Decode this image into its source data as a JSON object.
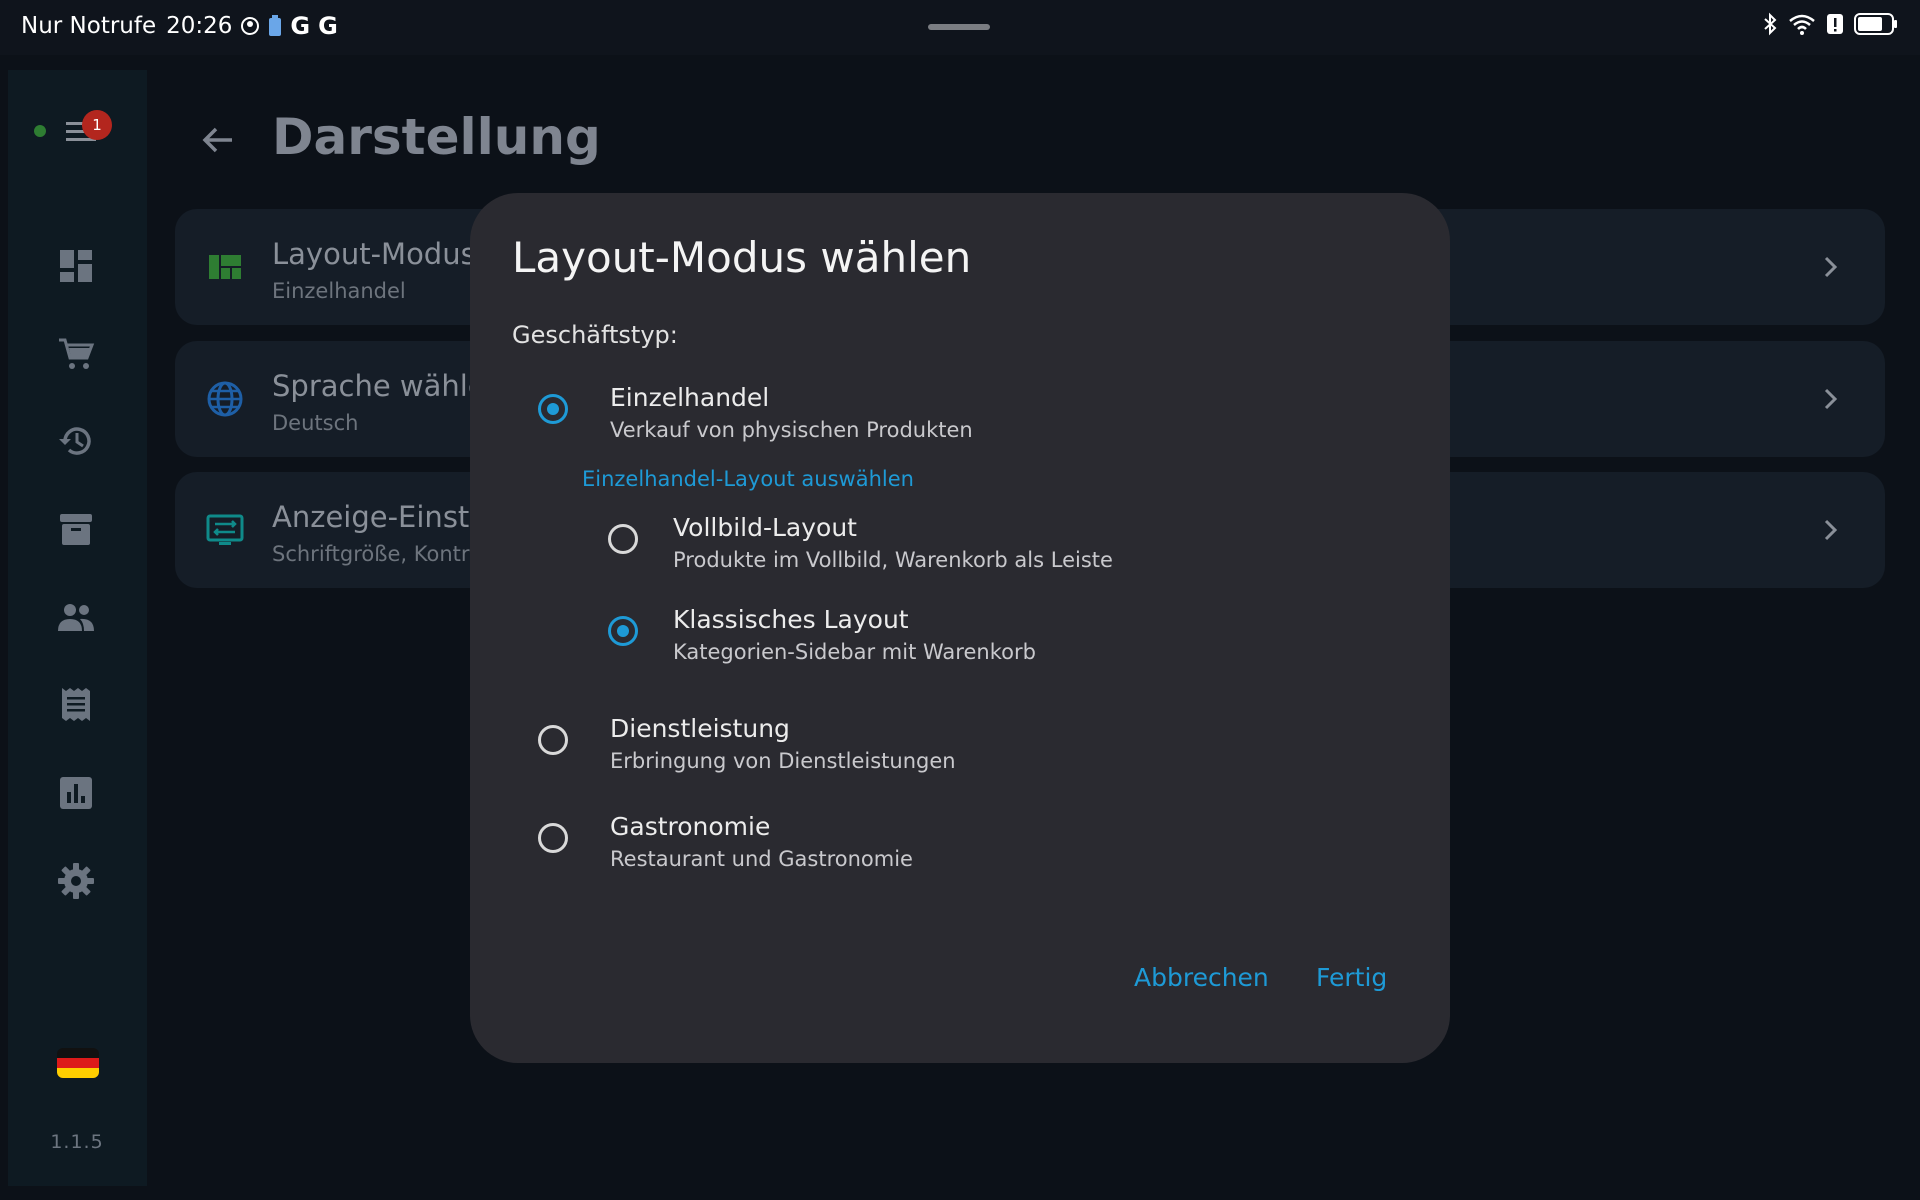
{
  "status_bar": {
    "carrier": "Nur Notrufe",
    "time": "20:26",
    "google_letter_1": "G",
    "google_letter_2": "G"
  },
  "rail": {
    "notification_count": "1",
    "version": "1.1.5",
    "flag": "de",
    "items": [
      "dashboard-icon",
      "cart-icon",
      "history-icon",
      "archive-icon",
      "people-icon",
      "receipt-icon",
      "chart-icon",
      "gear-icon"
    ]
  },
  "page": {
    "title": "Darstellung",
    "settings": [
      {
        "title": "Layout-Modus",
        "subtitle": "Einzelhandel",
        "icon": "layout-icon"
      },
      {
        "title": "Sprache wähle",
        "subtitle": "Deutsch",
        "icon": "globe-icon"
      },
      {
        "title": "Anzeige-Einst",
        "subtitle": "Schriftgröße, Kontr",
        "icon": "display-settings-icon"
      }
    ]
  },
  "dialog": {
    "title": "Layout-Modus wählen",
    "label": "Geschäftstyp:",
    "options": [
      {
        "title": "Einzelhandel",
        "subtitle": "Verkauf von physischen Produkten",
        "selected": true
      },
      {
        "title": "Dienstleistung",
        "subtitle": "Erbringung von Dienstleistungen",
        "selected": false
      },
      {
        "title": "Gastronomie",
        "subtitle": "Restaurant und Gastronomie",
        "selected": false
      }
    ],
    "sub_heading": "Einzelhandel-Layout auswählen",
    "sub_options": [
      {
        "title": "Vollbild-Layout",
        "subtitle": "Produkte im Vollbild, Warenkorb als Leiste",
        "selected": false
      },
      {
        "title": "Klassisches Layout",
        "subtitle": "Kategorien-Sidebar mit Warenkorb",
        "selected": true
      }
    ],
    "cancel_label": "Abbrechen",
    "done_label": "Fertig"
  },
  "colors": {
    "accent": "#1e9ad6",
    "dialog_bg": "#2a2a30",
    "page_bg": "#0c1118"
  }
}
